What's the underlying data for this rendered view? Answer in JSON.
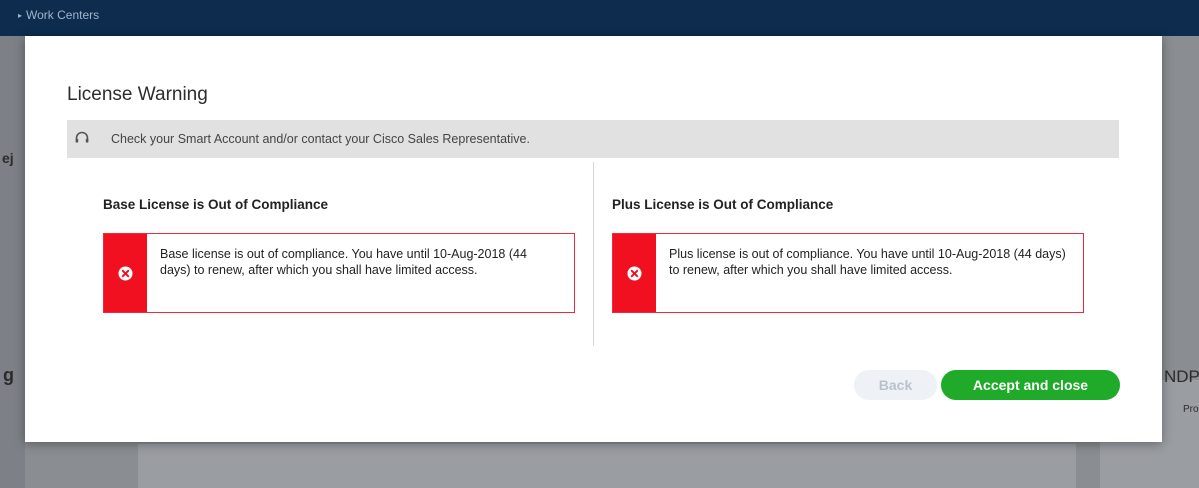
{
  "background": {
    "topbar": {
      "nav_item": "Work Centers"
    },
    "fragments": {
      "left_top": "ej",
      "left_mid": "g",
      "right_top": "",
      "right_mid": "NDP",
      "right_sub": "Pro"
    }
  },
  "modal": {
    "title": "License Warning",
    "info": {
      "icon": "headset-icon",
      "text": "Check your Smart Account and/or contact your Cisco Sales Representative."
    },
    "columns": [
      {
        "heading": "Base License is Out of Compliance",
        "alert_icon": "error-circle-icon",
        "message": "Base license is out of compliance. You have until 10-Aug-2018 (44 days) to renew, after which you shall have limited access."
      },
      {
        "heading": "Plus License is Out of Compliance",
        "alert_icon": "error-circle-icon",
        "message": "Plus license is out of compliance. You have until 10-Aug-2018 (44 days) to renew, after which you shall have limited access."
      }
    ],
    "buttons": {
      "back_label": "Back",
      "accept_label": "Accept and close"
    }
  },
  "colors": {
    "topbar": "#0d2c4e",
    "alert_red": "#f0101f",
    "accept_green": "#1faa2a",
    "info_bar": "#e1e1e1"
  }
}
